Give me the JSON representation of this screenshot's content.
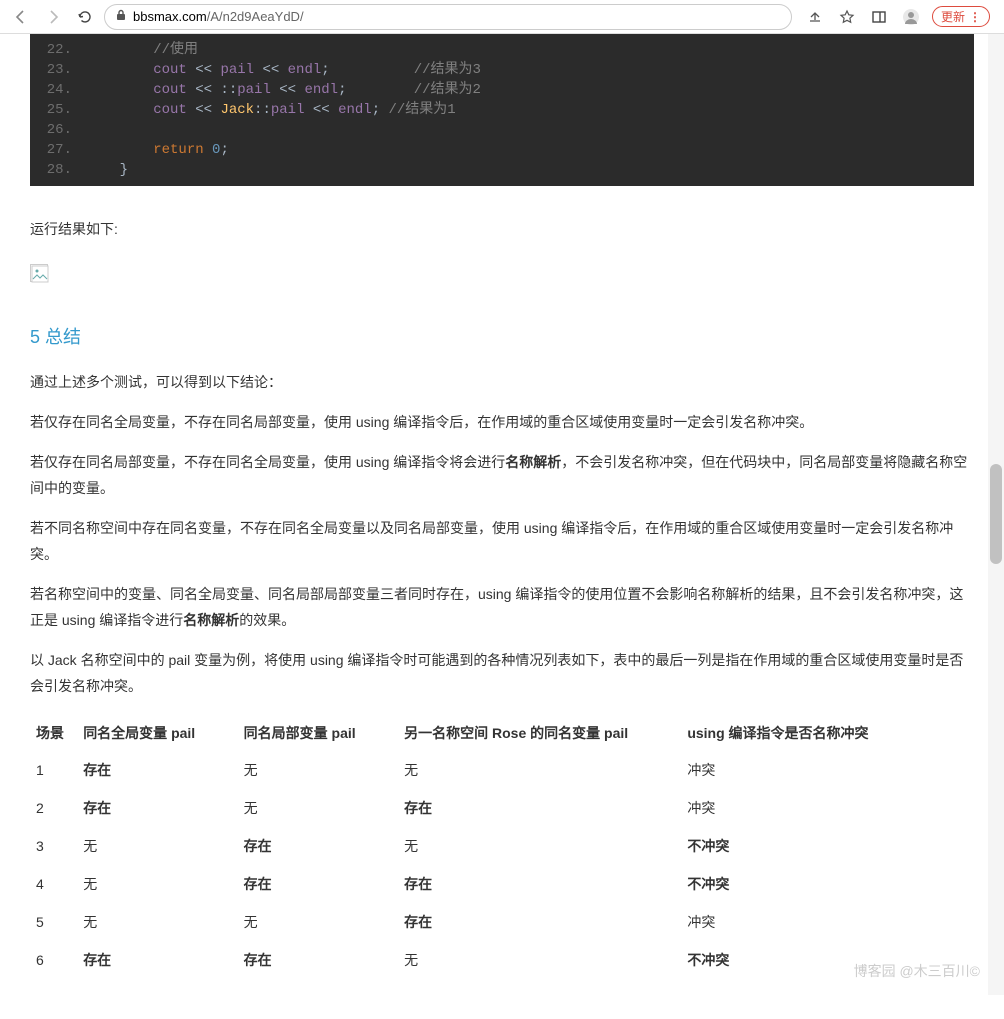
{
  "browser": {
    "url_host": "bbsmax.com",
    "url_path": "/A/n2d9AeaYdD/",
    "update_label": "更新"
  },
  "code": {
    "lines": [
      22,
      23,
      24,
      25,
      26,
      27,
      28
    ],
    "l22_indent": "        ",
    "l22_cmt": "//使用",
    "l23_indent": "        ",
    "l23_cout": "cout",
    "l23_op1": " << ",
    "l23_var": "pail",
    "l23_op2": " << ",
    "l23_endl": "endl",
    "l23_semi": ";",
    "l23_pad": "          ",
    "l23_cmt": "//结果为3",
    "l24_indent": "        ",
    "l24_cout": "cout",
    "l24_op1": " << ::",
    "l24_var": "pail",
    "l24_op2": " << ",
    "l24_endl": "endl",
    "l24_semi": ";",
    "l24_pad": "        ",
    "l24_cmt": "//结果为2",
    "l25_indent": "        ",
    "l25_cout": "cout",
    "l25_op1": " << ",
    "l25_ns": "Jack",
    "l25_sep": "::",
    "l25_var": "pail",
    "l25_op2": " << ",
    "l25_endl": "endl",
    "l25_semi": ";",
    "l25_pad": " ",
    "l25_cmt": "//结果为1",
    "l27_indent": "        ",
    "l27_ret": "return",
    "l27_sp": " ",
    "l27_zero": "0",
    "l27_semi": ";",
    "l28_brace": "    }"
  },
  "text": {
    "result_intro": "运行结果如下:",
    "h_summary": "5 总结",
    "p_intro": "通过上述多个测试，可以得到以下结论：",
    "p1_a": "若仅存在同名全局变量，不存在同名局部变量，使用 using 编译指令后，在作用域的重合区域使用变量时一定会引发名称冲突。",
    "p2_a": "若仅存在同名局部变量，不存在同名全局变量，使用 using 编译指令将会进行",
    "p2_b": "名称解析",
    "p2_c": "，不会引发名称冲突，但在代码块中，同名局部变量将隐藏名称空间中的变量。",
    "p3_a": "若不同名称空间中存在同名变量，不存在同名全局变量以及同名局部变量，使用 using 编译指令后，在作用域的重合区域使用变量时一定会引发名称冲突。",
    "p4_a": "若名称空间中的变量、同名全局变量、同名局部局部变量三者同时存在，using 编译指令的使用位置不会影响名称解析的结果，且不会引发名称冲突，这正是 using 编译指令进行",
    "p4_b": "名称解析",
    "p4_c": "的效果。",
    "p5": "以 Jack 名称空间中的 pail 变量为例，将使用 using 编译指令时可能遇到的各种情况列表如下，表中的最后一列是指在作用域的重合区域使用变量时是否会引发名称冲突。"
  },
  "table": {
    "headers": [
      "场景",
      "同名全局变量 pail",
      "同名局部变量 pail",
      "另一名称空间 Rose 的同名变量 pail",
      "using 编译指令是否名称冲突"
    ],
    "rows": [
      {
        "n": "1",
        "c1": "存在",
        "c1b": true,
        "c2": "无",
        "c2b": false,
        "c3": "无",
        "c3b": false,
        "c4": "冲突",
        "c4b": false
      },
      {
        "n": "2",
        "c1": "存在",
        "c1b": true,
        "c2": "无",
        "c2b": false,
        "c3": "存在",
        "c3b": true,
        "c4": "冲突",
        "c4b": false
      },
      {
        "n": "3",
        "c1": "无",
        "c1b": false,
        "c2": "存在",
        "c2b": true,
        "c3": "无",
        "c3b": false,
        "c4": "不冲突",
        "c4b": true
      },
      {
        "n": "4",
        "c1": "无",
        "c1b": false,
        "c2": "存在",
        "c2b": true,
        "c3": "存在",
        "c3b": true,
        "c4": "不冲突",
        "c4b": true
      },
      {
        "n": "5",
        "c1": "无",
        "c1b": false,
        "c2": "无",
        "c2b": false,
        "c3": "存在",
        "c3b": true,
        "c4": "冲突",
        "c4b": false
      },
      {
        "n": "6",
        "c1": "存在",
        "c1b": true,
        "c2": "存在",
        "c2b": true,
        "c3": "无",
        "c3b": false,
        "c4": "不冲突",
        "c4b": true
      }
    ]
  },
  "watermark": "博客园 @木三百川©"
}
